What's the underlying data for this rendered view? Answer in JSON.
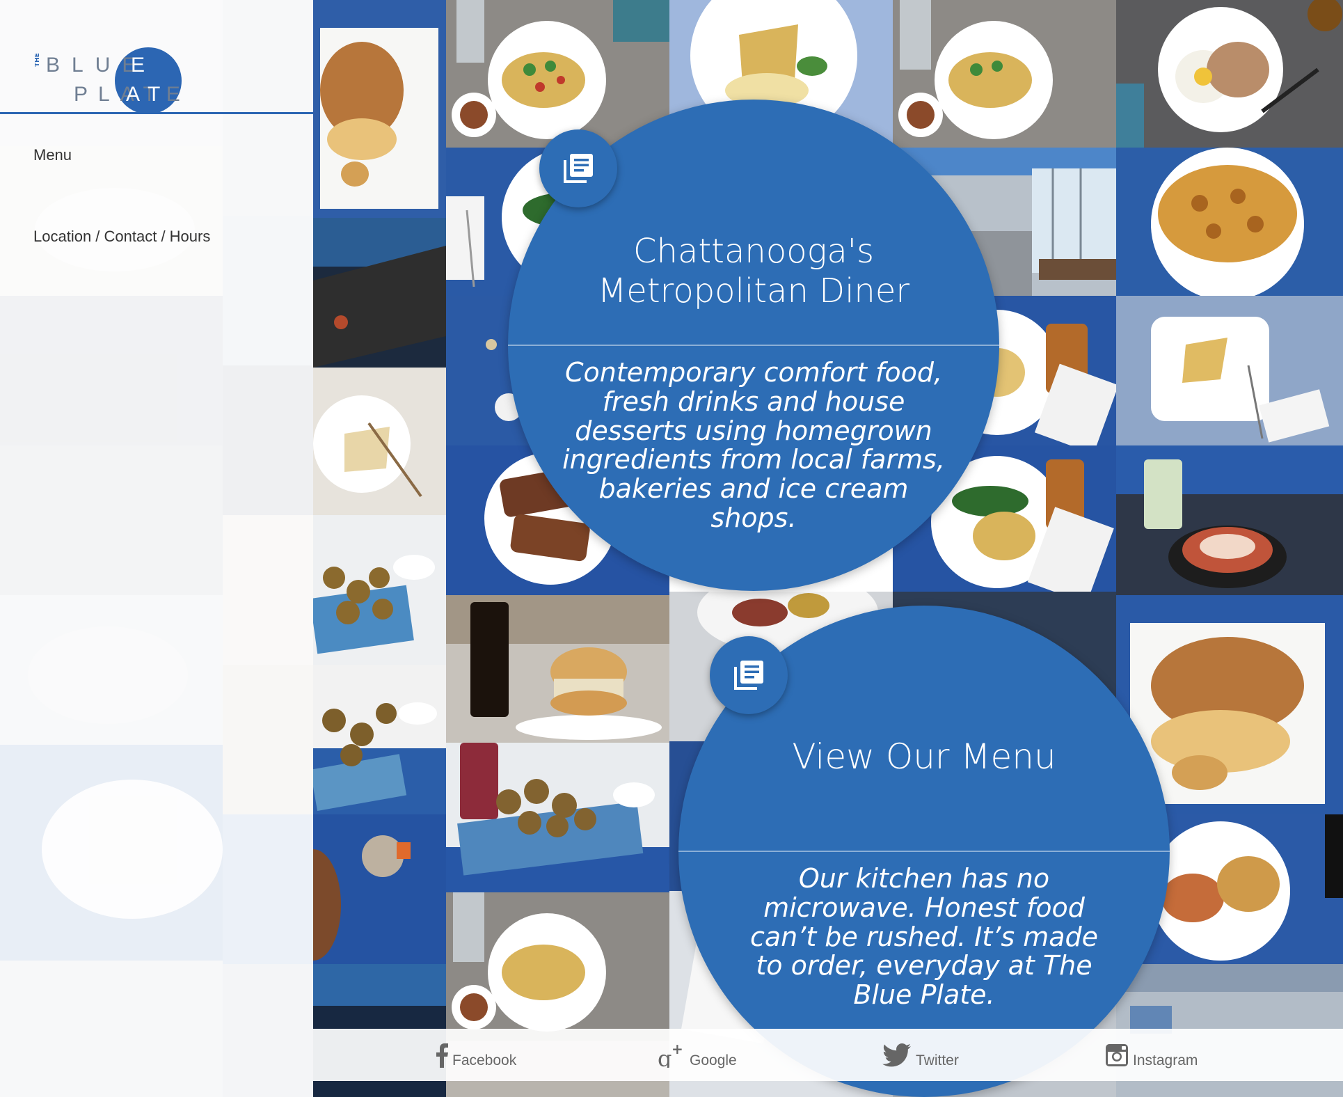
{
  "brand": {
    "the": "THE",
    "word1": "BLUE",
    "word2": "PLATE",
    "accent_color": "#2d6db5"
  },
  "nav": {
    "items": [
      {
        "label": "Menu"
      },
      {
        "label": "Location / Contact / Hours"
      }
    ]
  },
  "hero": {
    "icon": "menu-list-icon",
    "title_line1": "Chattanooga's",
    "title_line2": "Metropolitan Diner",
    "description": "Contemporary comfort food, fresh drinks and house desserts using homegrown ingredients from local farms, bakeries and ice cream shops."
  },
  "menu_promo": {
    "icon": "menu-list-icon",
    "title": "View Our Menu",
    "description": "Our kitchen has no microwave. Honest food can’t be rushed. It’s made to order, everyday at The Blue Plate."
  },
  "social": {
    "facebook": {
      "label": "Facebook",
      "icon": "facebook-icon"
    },
    "google": {
      "label": "Google",
      "icon": "google-plus-icon"
    },
    "twitter": {
      "label": "Twitter",
      "icon": "twitter-icon"
    },
    "instagram": {
      "label": "Instagram",
      "icon": "instagram-icon"
    }
  }
}
